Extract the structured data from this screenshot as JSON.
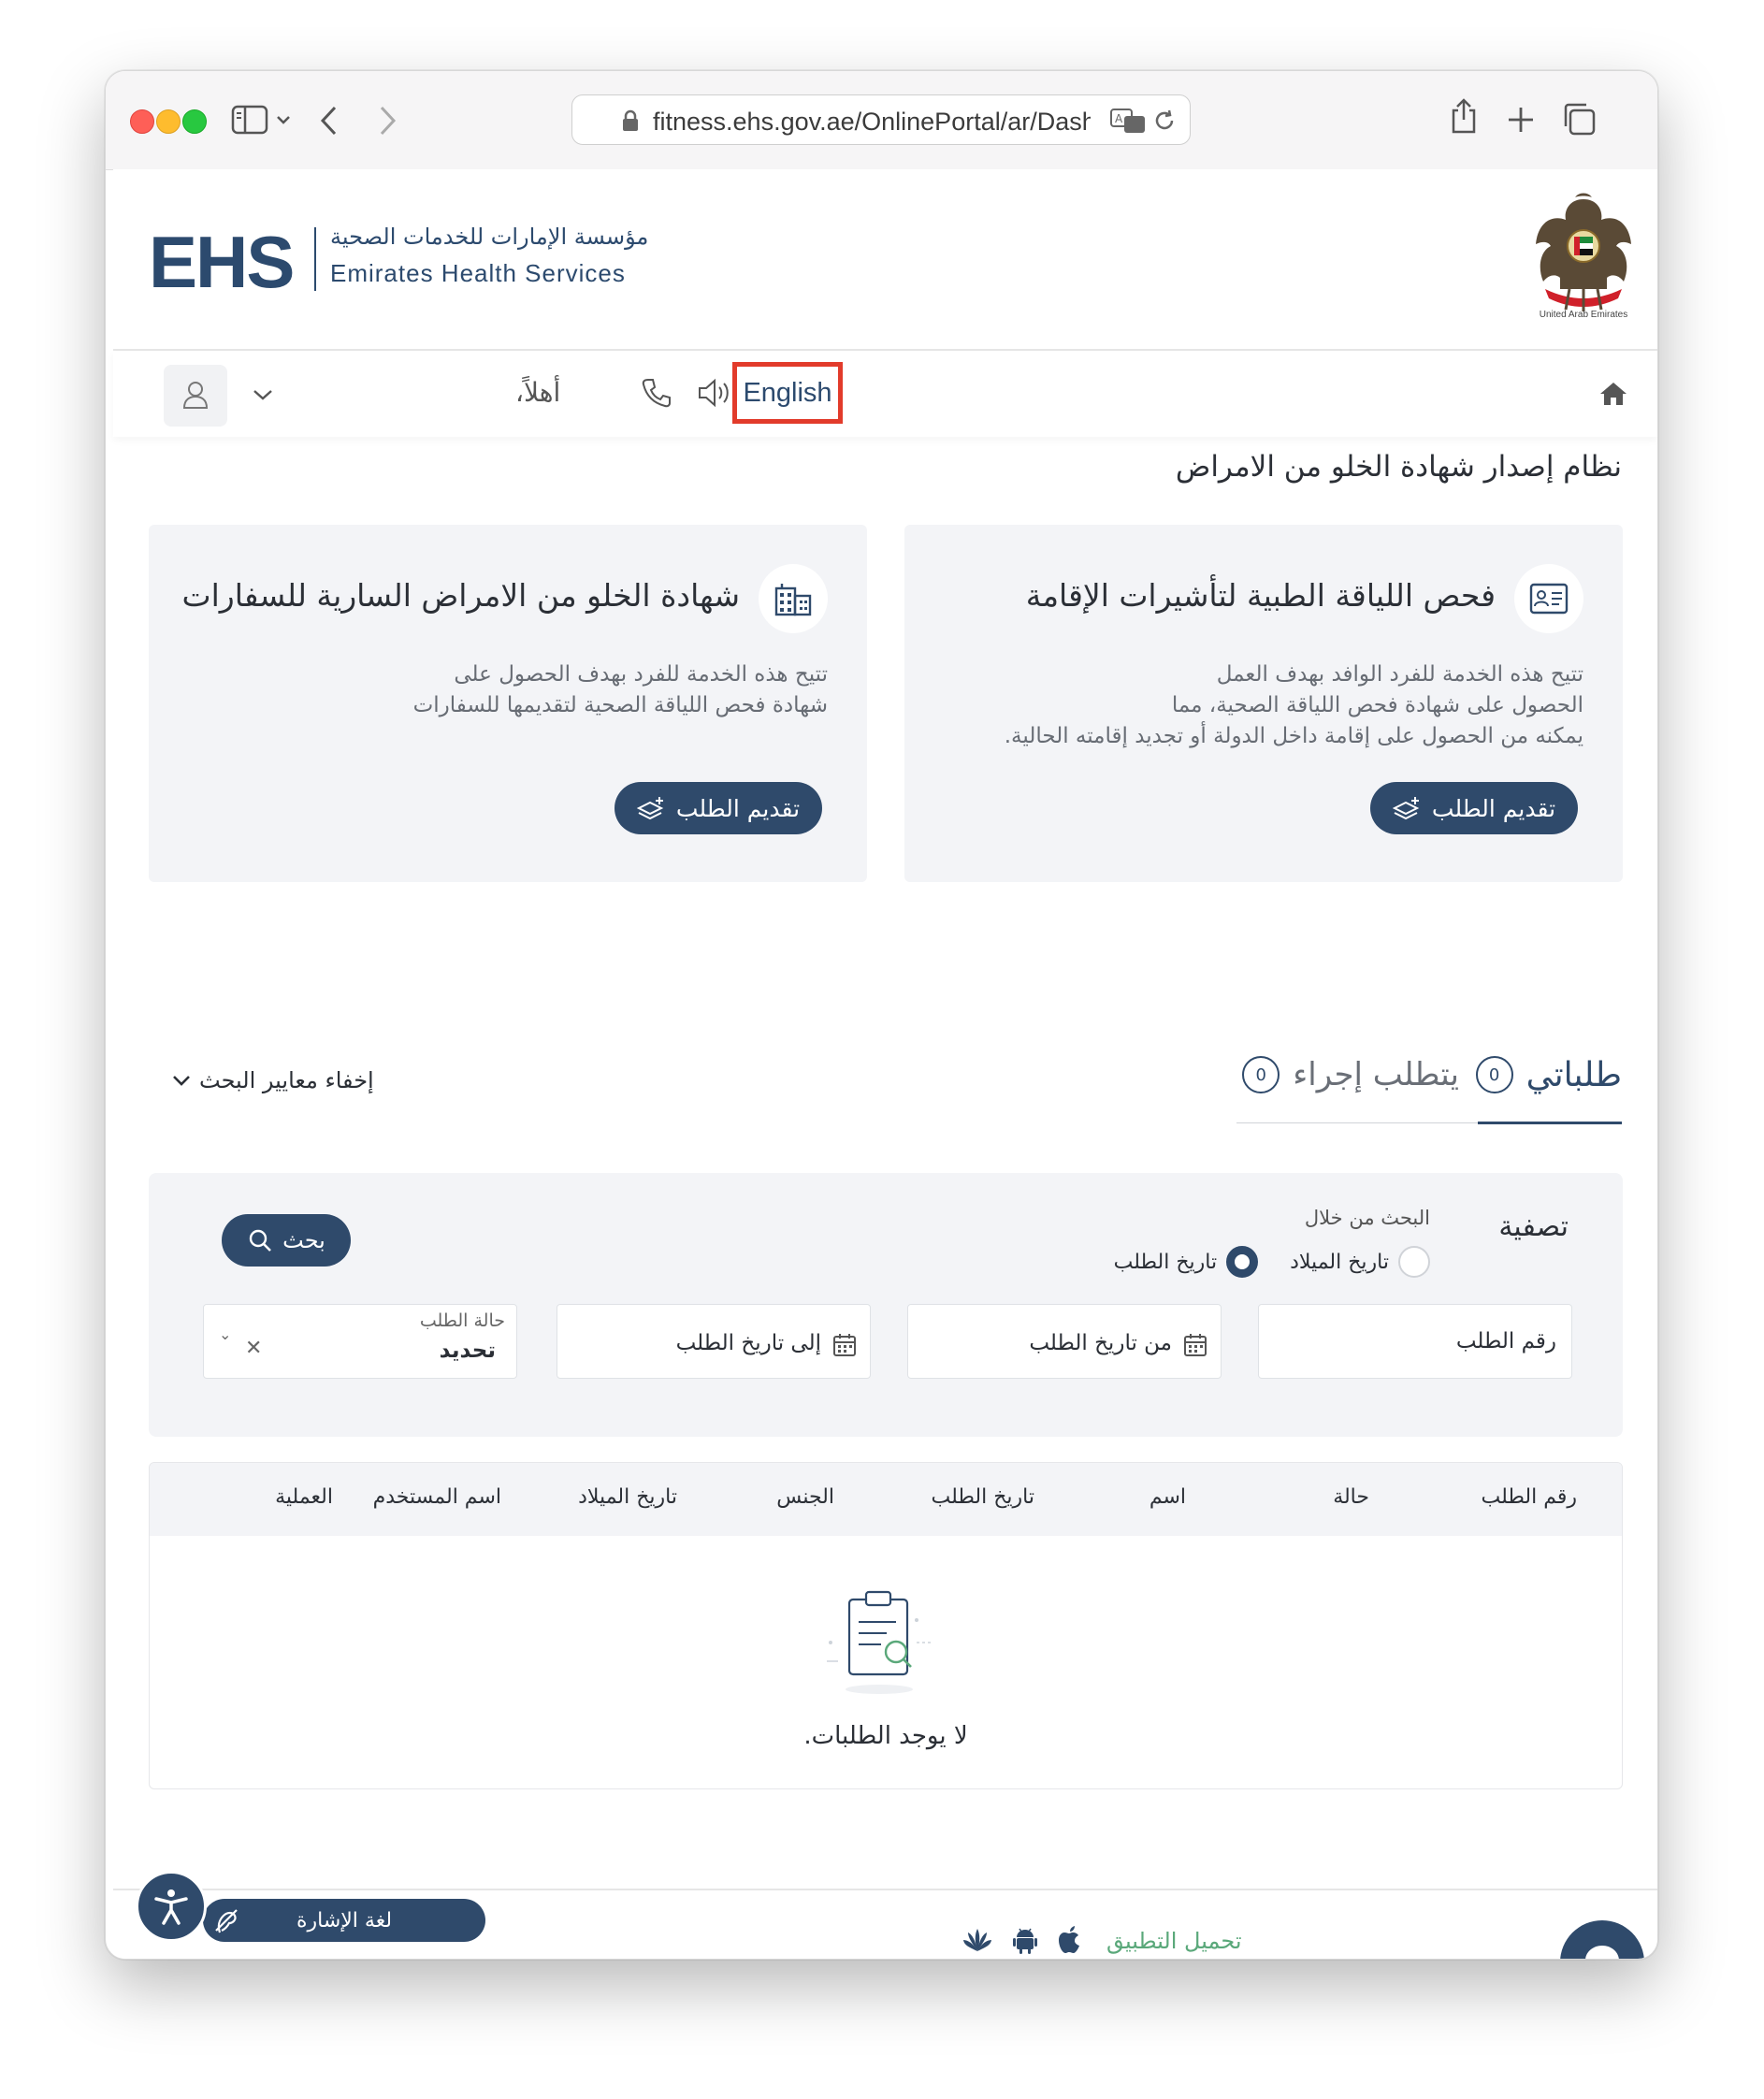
{
  "browser": {
    "url": "fitness.ehs.gov.ae/OnlinePortal/ar/Dash"
  },
  "header": {
    "logo_text": "EHS",
    "org_name_ar": "مؤسسة الإمارات للخدمات الصحية",
    "org_name_en": "Emirates Health Services",
    "emblem_caption": "United Arab Emirates"
  },
  "nav": {
    "language_button": "English",
    "greeting": "أهلاً،"
  },
  "page_title": "نظام إصدار شهادة الخلو من الامراض",
  "cards": [
    {
      "title": "فحص اللياقة الطبية لتأشيرات الإقامة",
      "description": [
        "تتيح هذه الخدمة للفرد الوافد بهدف العمل",
        "الحصول على شهادة فحص اللياقة الصحية، مما",
        "يمكنه من الحصول على إقامة داخل الدولة أو تجديد إقامته الحالية."
      ],
      "button": "تقديم الطلب"
    },
    {
      "title": "شهادة الخلو من الامراض السارية للسفارات",
      "description": [
        "تتيح هذه الخدمة للفرد بهدف الحصول على",
        "شهادة فحص اللياقة الصحية لتقديمها للسفارات"
      ],
      "button": "تقديم الطلب"
    }
  ],
  "tabs": [
    {
      "label": "طلباتي",
      "count": "0"
    },
    {
      "label": "يتطلب إجراء",
      "count": "0"
    }
  ],
  "hide_filters": "إخفاء معايير البحث",
  "filter": {
    "title": "تصفية",
    "search_by": "البحث من خلال",
    "radio_dob": "تاريخ الميلاد",
    "radio_request_date": "تاريخ الطلب",
    "search_button": "بحث",
    "request_number": "رقم الطلب",
    "from_date": "من تاريخ الطلب",
    "to_date": "إلى تاريخ الطلب",
    "status_label": "حالة الطلب",
    "status_value": "تحديد"
  },
  "table": {
    "columns": [
      "رقم الطلب",
      "حالة",
      "اسم",
      "تاريخ الطلب",
      "الجنس",
      "تاريخ الميلاد",
      "اسم المستخدم",
      "العملية"
    ],
    "empty_text": "لا يوجد الطلبات."
  },
  "footer": {
    "download_app": "تحميل التطبيق",
    "sign_language": "لغة الإشارة"
  },
  "colors": {
    "primary": "#2f4a6b",
    "highlight": "#e23b2b",
    "card_bg": "#f3f4f7",
    "accent_green": "#5aa87a"
  }
}
